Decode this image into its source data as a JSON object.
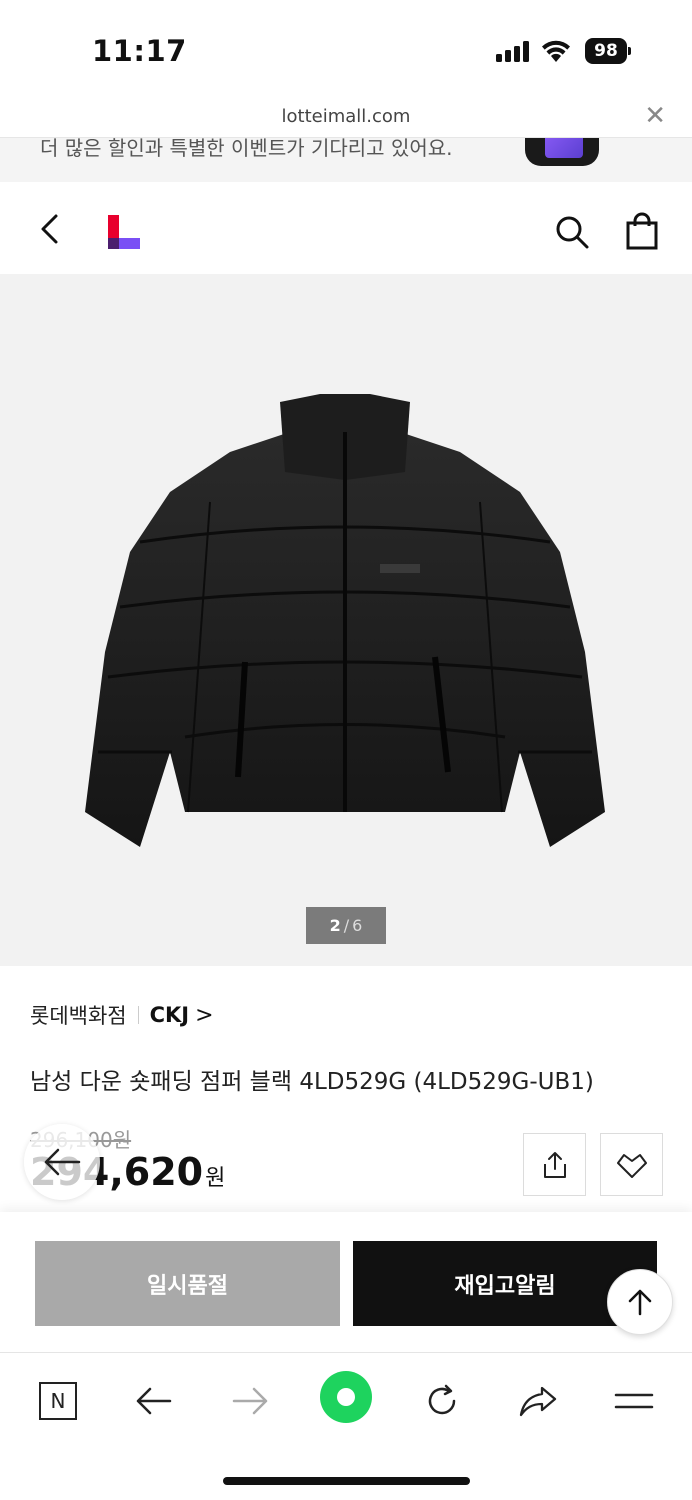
{
  "status_bar": {
    "time": "11:17",
    "battery": "98"
  },
  "browser": {
    "url": "lotteimall.com"
  },
  "promo": {
    "text": "더 많은 할인과 특별한 이벤트가 기다리고 있어요."
  },
  "product": {
    "image_counter": {
      "current": "2",
      "separator": "/",
      "total": "6"
    },
    "store": "롯데백화점",
    "brand": "CKJ",
    "brand_chevron": ">",
    "title": "남성 다운 숏패딩 점퍼 블랙 4LD529G (4LD529G-UB1)",
    "original_price": "296,100원",
    "sale_price": "294,620",
    "sale_unit": "원"
  },
  "actions": {
    "soldout_label": "일시품절",
    "restock_label": "재입고알림"
  },
  "colors": {
    "logo_red": "#e8002d",
    "logo_purple": "#7a4ff5",
    "naver_green": "#1ed35e",
    "soldout_gray": "#a9a9a9",
    "restock_black": "#111111"
  }
}
